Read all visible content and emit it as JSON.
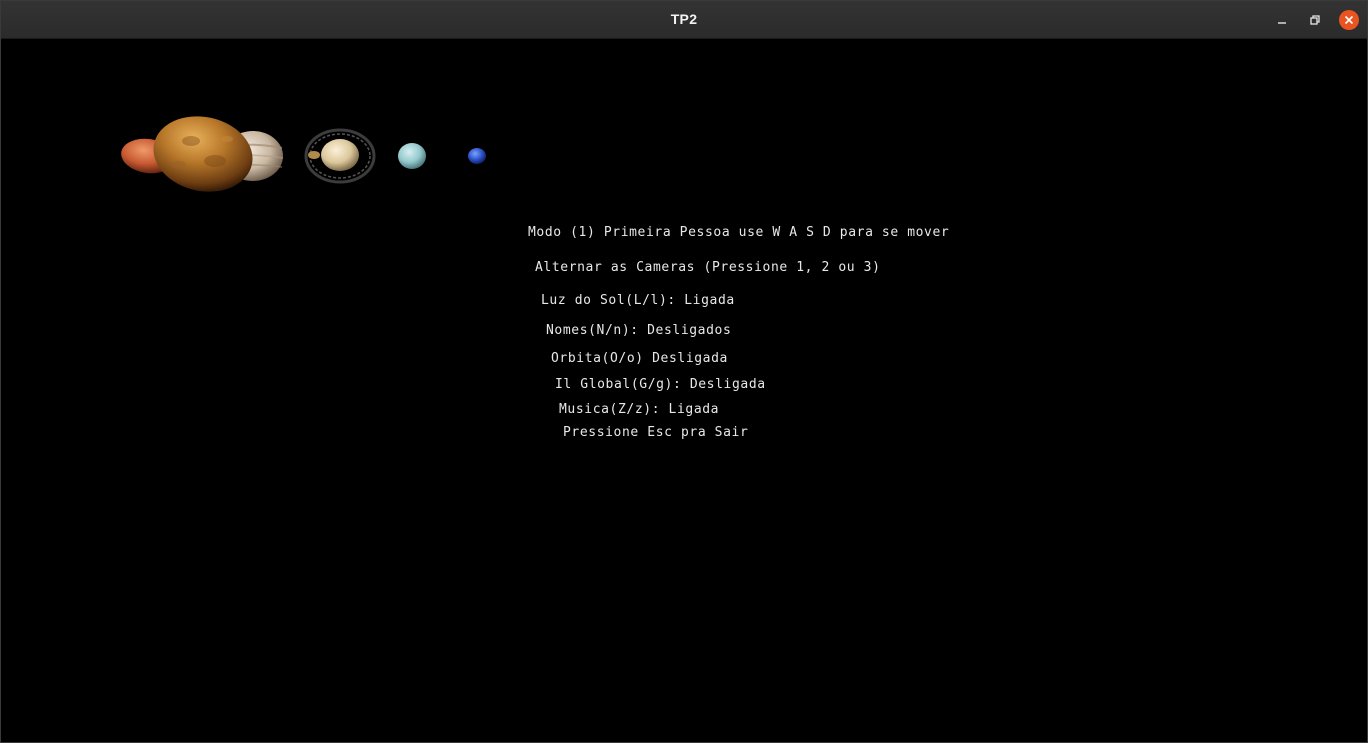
{
  "window": {
    "title": "TP2",
    "controls": {
      "minimize_icon": "minimize-icon",
      "maximize_icon": "restore-icon",
      "close_icon": "close-icon",
      "close_color": "#e95420"
    }
  },
  "scene": {
    "background": "#000000",
    "planets": [
      "mars",
      "venus",
      "jupiter",
      "saturn",
      "uranus",
      "neptune"
    ]
  },
  "hud": {
    "mode": "Modo (1) Primeira Pessoa use W A S D para se mover",
    "cameras": "Alternar as Cameras (Pressione 1, 2 ou 3)",
    "sunlight": "Luz do Sol(L/l): Ligada",
    "names": "Nomes(N/n): Desligados",
    "orbit": "Orbita(O/o) Desligada",
    "global_light": "Il Global(G/g): Desligada",
    "music": "Musica(Z/z): Ligada",
    "exit": "Pressione Esc pra Sair"
  }
}
